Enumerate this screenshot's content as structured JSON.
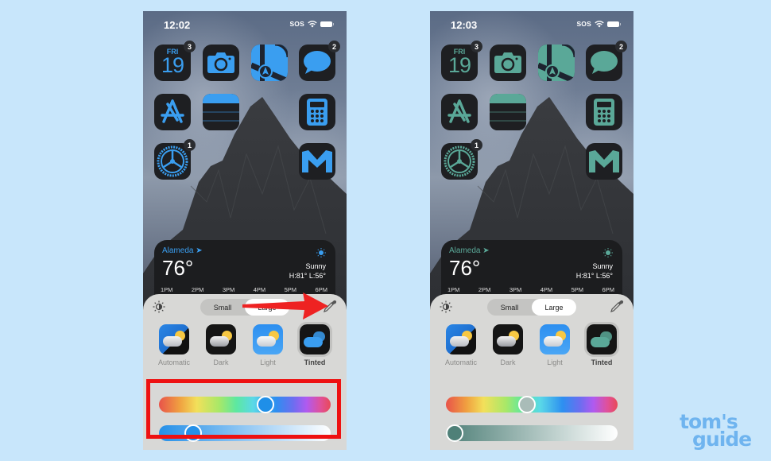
{
  "screenshots": [
    {
      "id": "before",
      "status": {
        "time": "12:02",
        "carrier": "SOS"
      },
      "theme_accent": "#3a9ef0",
      "apps": [
        {
          "name": "Calendar",
          "icon": "calendar-icon",
          "day": "FRI",
          "date": "19",
          "badge": "3"
        },
        {
          "name": "Camera",
          "icon": "camera-icon"
        },
        {
          "name": "Maps",
          "icon": "maps-icon"
        },
        {
          "name": "Messages",
          "icon": "messages-icon",
          "badge": "2"
        },
        {
          "name": "App Store",
          "icon": "app-store-icon"
        },
        {
          "name": "Notes",
          "icon": "notes-icon"
        },
        {
          "name": "Calculator",
          "icon": "calculator-icon"
        },
        {
          "name": "Settings",
          "icon": "settings-gear-icon",
          "badge": "1"
        },
        {
          "name": "Gmail",
          "icon": "gmail-m-icon"
        }
      ],
      "weather": {
        "city": "Alameda",
        "temp": "76°",
        "condition": "Sunny",
        "high_low": "H:81° L:56°",
        "hours": [
          "1PM",
          "2PM",
          "3PM",
          "4PM",
          "5PM",
          "6PM"
        ]
      },
      "sheet": {
        "size_options": [
          "Small",
          "Large"
        ],
        "selected_size": "Large",
        "styles": [
          {
            "label": "Automatic"
          },
          {
            "label": "Dark"
          },
          {
            "label": "Light"
          },
          {
            "label": "Tinted"
          }
        ],
        "selected_style": "Tinted",
        "hue_position": 0.62,
        "saturation_position": 0.2,
        "thumb_color": "#1f8fe8",
        "sat_start": "#2590e8"
      }
    },
    {
      "id": "after",
      "status": {
        "time": "12:03",
        "carrier": "SOS"
      },
      "theme_accent": "#5aa898",
      "apps": [
        {
          "name": "Calendar",
          "icon": "calendar-icon",
          "day": "FRI",
          "date": "19",
          "badge": "3"
        },
        {
          "name": "Camera",
          "icon": "camera-icon"
        },
        {
          "name": "Maps",
          "icon": "maps-icon"
        },
        {
          "name": "Messages",
          "icon": "messages-icon",
          "badge": "2"
        },
        {
          "name": "App Store",
          "icon": "app-store-icon"
        },
        {
          "name": "Notes",
          "icon": "notes-icon"
        },
        {
          "name": "Calculator",
          "icon": "calculator-icon"
        },
        {
          "name": "Settings",
          "icon": "settings-gear-icon",
          "badge": "1"
        },
        {
          "name": "Gmail",
          "icon": "gmail-m-icon"
        }
      ],
      "weather": {
        "city": "Alameda",
        "temp": "76°",
        "condition": "Sunny",
        "high_low": "H:81° L:56°",
        "hours": [
          "1PM",
          "2PM",
          "3PM",
          "4PM",
          "5PM",
          "6PM"
        ]
      },
      "sheet": {
        "size_options": [
          "Small",
          "Large"
        ],
        "selected_size": "Large",
        "styles": [
          {
            "label": "Automatic"
          },
          {
            "label": "Dark"
          },
          {
            "label": "Light"
          },
          {
            "label": "Tinted"
          }
        ],
        "selected_style": "Tinted",
        "hue_position": 0.47,
        "saturation_position": 0.05,
        "thumb_color": "#a9bcb8",
        "sat_start": "#4f8078"
      }
    }
  ],
  "annotation": {
    "highlight_color": "#ee1111",
    "arrow_target": "eyedropper"
  },
  "watermark": {
    "line1": "tom's",
    "line2": "guide"
  }
}
